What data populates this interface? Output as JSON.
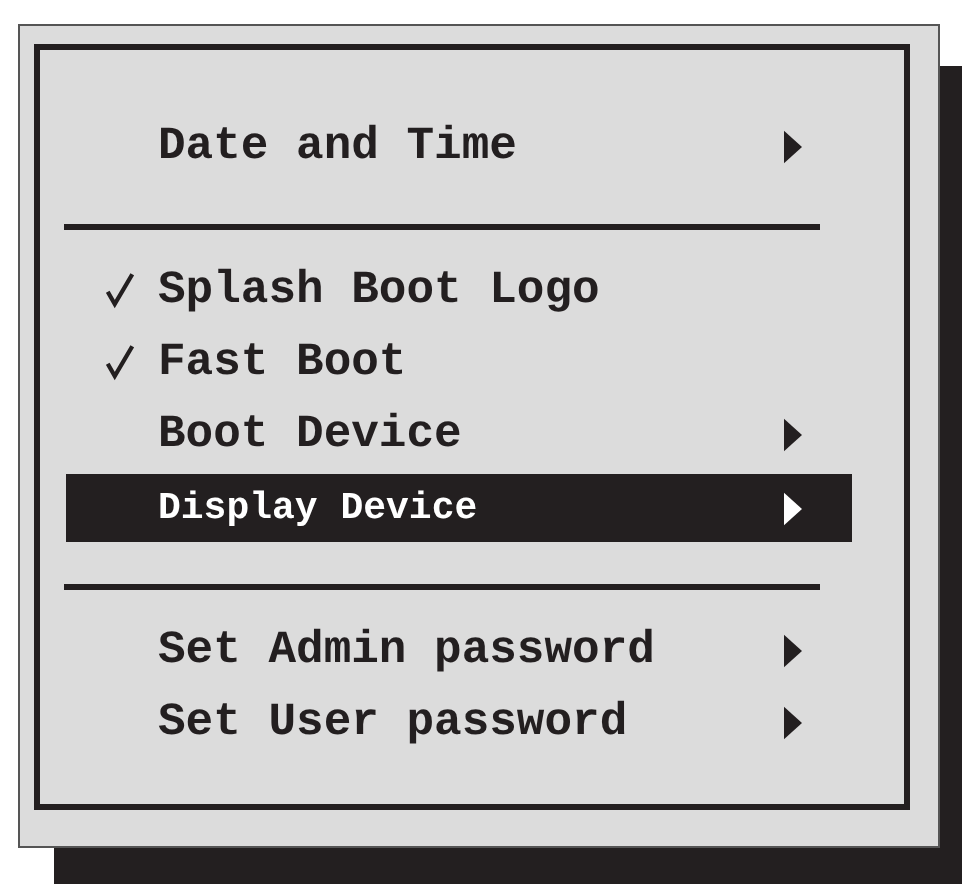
{
  "menu": {
    "groups": [
      {
        "items": [
          {
            "label": "Date and Time",
            "kind": "submenu",
            "checked": false,
            "selected": false
          }
        ]
      },
      {
        "items": [
          {
            "label": "Splash Boot Logo",
            "kind": "toggle",
            "checked": true,
            "selected": false
          },
          {
            "label": "Fast Boot",
            "kind": "toggle",
            "checked": true,
            "selected": false
          },
          {
            "label": "Boot Device",
            "kind": "submenu",
            "checked": false,
            "selected": false
          },
          {
            "label": "Display Device",
            "kind": "submenu",
            "checked": false,
            "selected": true
          }
        ]
      },
      {
        "items": [
          {
            "label": "Set Admin password",
            "kind": "submenu",
            "checked": false,
            "selected": false
          },
          {
            "label": "Set User password",
            "kind": "submenu",
            "checked": false,
            "selected": false
          }
        ]
      }
    ]
  }
}
